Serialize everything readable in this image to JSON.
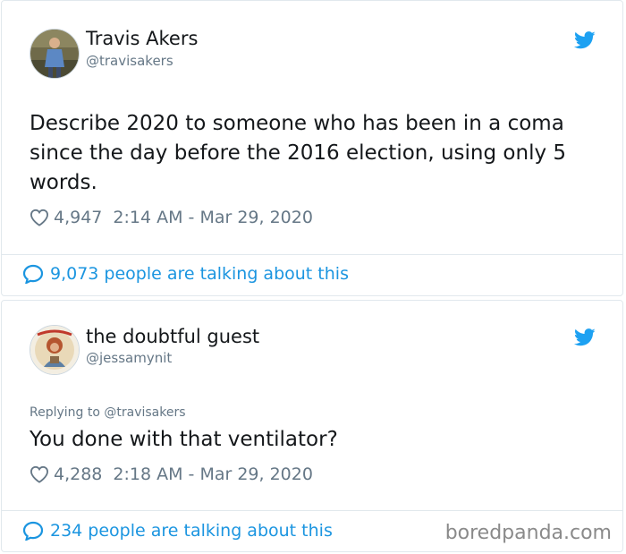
{
  "tweets": [
    {
      "author_name": "Travis Akers",
      "author_handle": "@travisakers",
      "reply_to": "",
      "text": "Describe 2020 to someone who has been in a coma since the day before the 2016 election, using only 5 words.",
      "likes": "4,947",
      "timestamp": "2:14 AM - Mar 29, 2020",
      "talking": "9,073 people are talking about this",
      "avatar_icon": "person-photo-avatar",
      "brand_icon": "twitter-bird-icon"
    },
    {
      "author_name": "the doubtful guest",
      "author_handle": "@jessamynit",
      "reply_to": "Replying to @travisakers",
      "text": "You done with that ventilator?",
      "likes": "4,288",
      "timestamp": "2:18 AM - Mar 29, 2020",
      "talking": "234 people are talking about this",
      "avatar_icon": "person-photo-avatar",
      "brand_icon": "twitter-bird-icon"
    }
  ],
  "watermark": "boredpanda.com",
  "colors": {
    "twitter_blue": "#1da1f2",
    "link_blue": "#1b95e0",
    "secondary_text": "#657786",
    "border": "#e1e8ed"
  }
}
